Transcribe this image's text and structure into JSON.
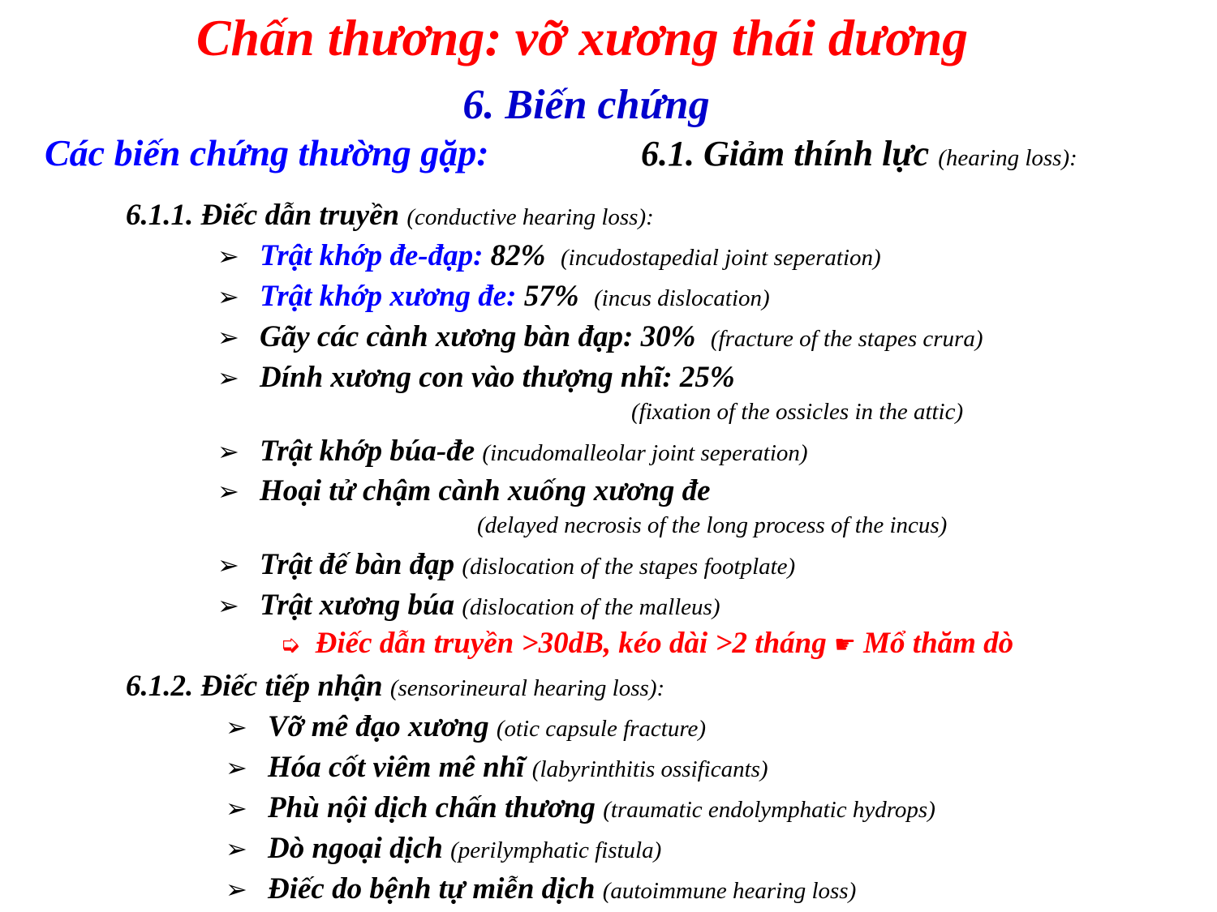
{
  "title": "Chấn thương: vỡ xương thái dương",
  "subtitle": "6. Biến chứng",
  "common_label": "Các biến chứng thường gặp:",
  "section_61": {
    "label": "6.1. Giảm thính lực",
    "note": "(hearing loss):"
  },
  "section_611": {
    "label": "6.1.1. Điếc dẫn truyền",
    "note": "(conductive hearing loss):",
    "items": [
      {
        "label": "Trật khớp đe-đạp:",
        "value": "82%",
        "note": "(incudostapedial joint seperation)"
      },
      {
        "label": "Trật khớp xương đe:",
        "value": "57%",
        "note": "(incus dislocation)"
      },
      {
        "label": "Gãy các cành xương bàn đạp: 30%",
        "note": "(fracture of the stapes crura)"
      },
      {
        "label": "Dính xương con vào thượng nhĩ: 25%",
        "note": "(fixation of the ossicles in the attic)"
      },
      {
        "label": "Trật khớp búa-đe",
        "note": "(incudomalleolar joint seperation)"
      },
      {
        "label": "Hoại tử chậm cành xuống xương đe",
        "note": "(delayed necrosis of the long process of the incus)"
      },
      {
        "label": "Trật đế bàn đạp",
        "note": "(dislocation of the stapes footplate)"
      },
      {
        "label": "Trật xương búa",
        "note": "(dislocation of the malleus)"
      }
    ],
    "conclusion": {
      "symbol": "➭",
      "text": "Điếc dẫn truyền >30dB, kéo dài >2 tháng",
      "pointer": "☛",
      "action": "Mổ thăm dò"
    }
  },
  "section_612": {
    "label": "6.1.2. Điếc tiếp nhận",
    "note": "(sensorineural hearing loss):",
    "items": [
      {
        "label": "Vỡ mê đạo xương",
        "note": "(otic capsule fracture)"
      },
      {
        "label": "Hóa cốt viêm mê nhĩ",
        "note": "(labyrinthitis ossificants)"
      },
      {
        "label": "Phù nội dịch chấn thương",
        "note": "(traumatic endolymphatic hydrops)"
      },
      {
        "label": "Dò ngoại dịch",
        "note": "(perilymphatic fistula)"
      },
      {
        "label": "Điếc do bệnh tự miễn dịch",
        "note": "(autoimmune hearing loss)"
      }
    ]
  },
  "bullet_icon": "➢",
  "colors": {
    "title": "#ff0000",
    "subtitle": "#0000cc",
    "highlight": "#0000ff",
    "warning": "#ff0000"
  }
}
